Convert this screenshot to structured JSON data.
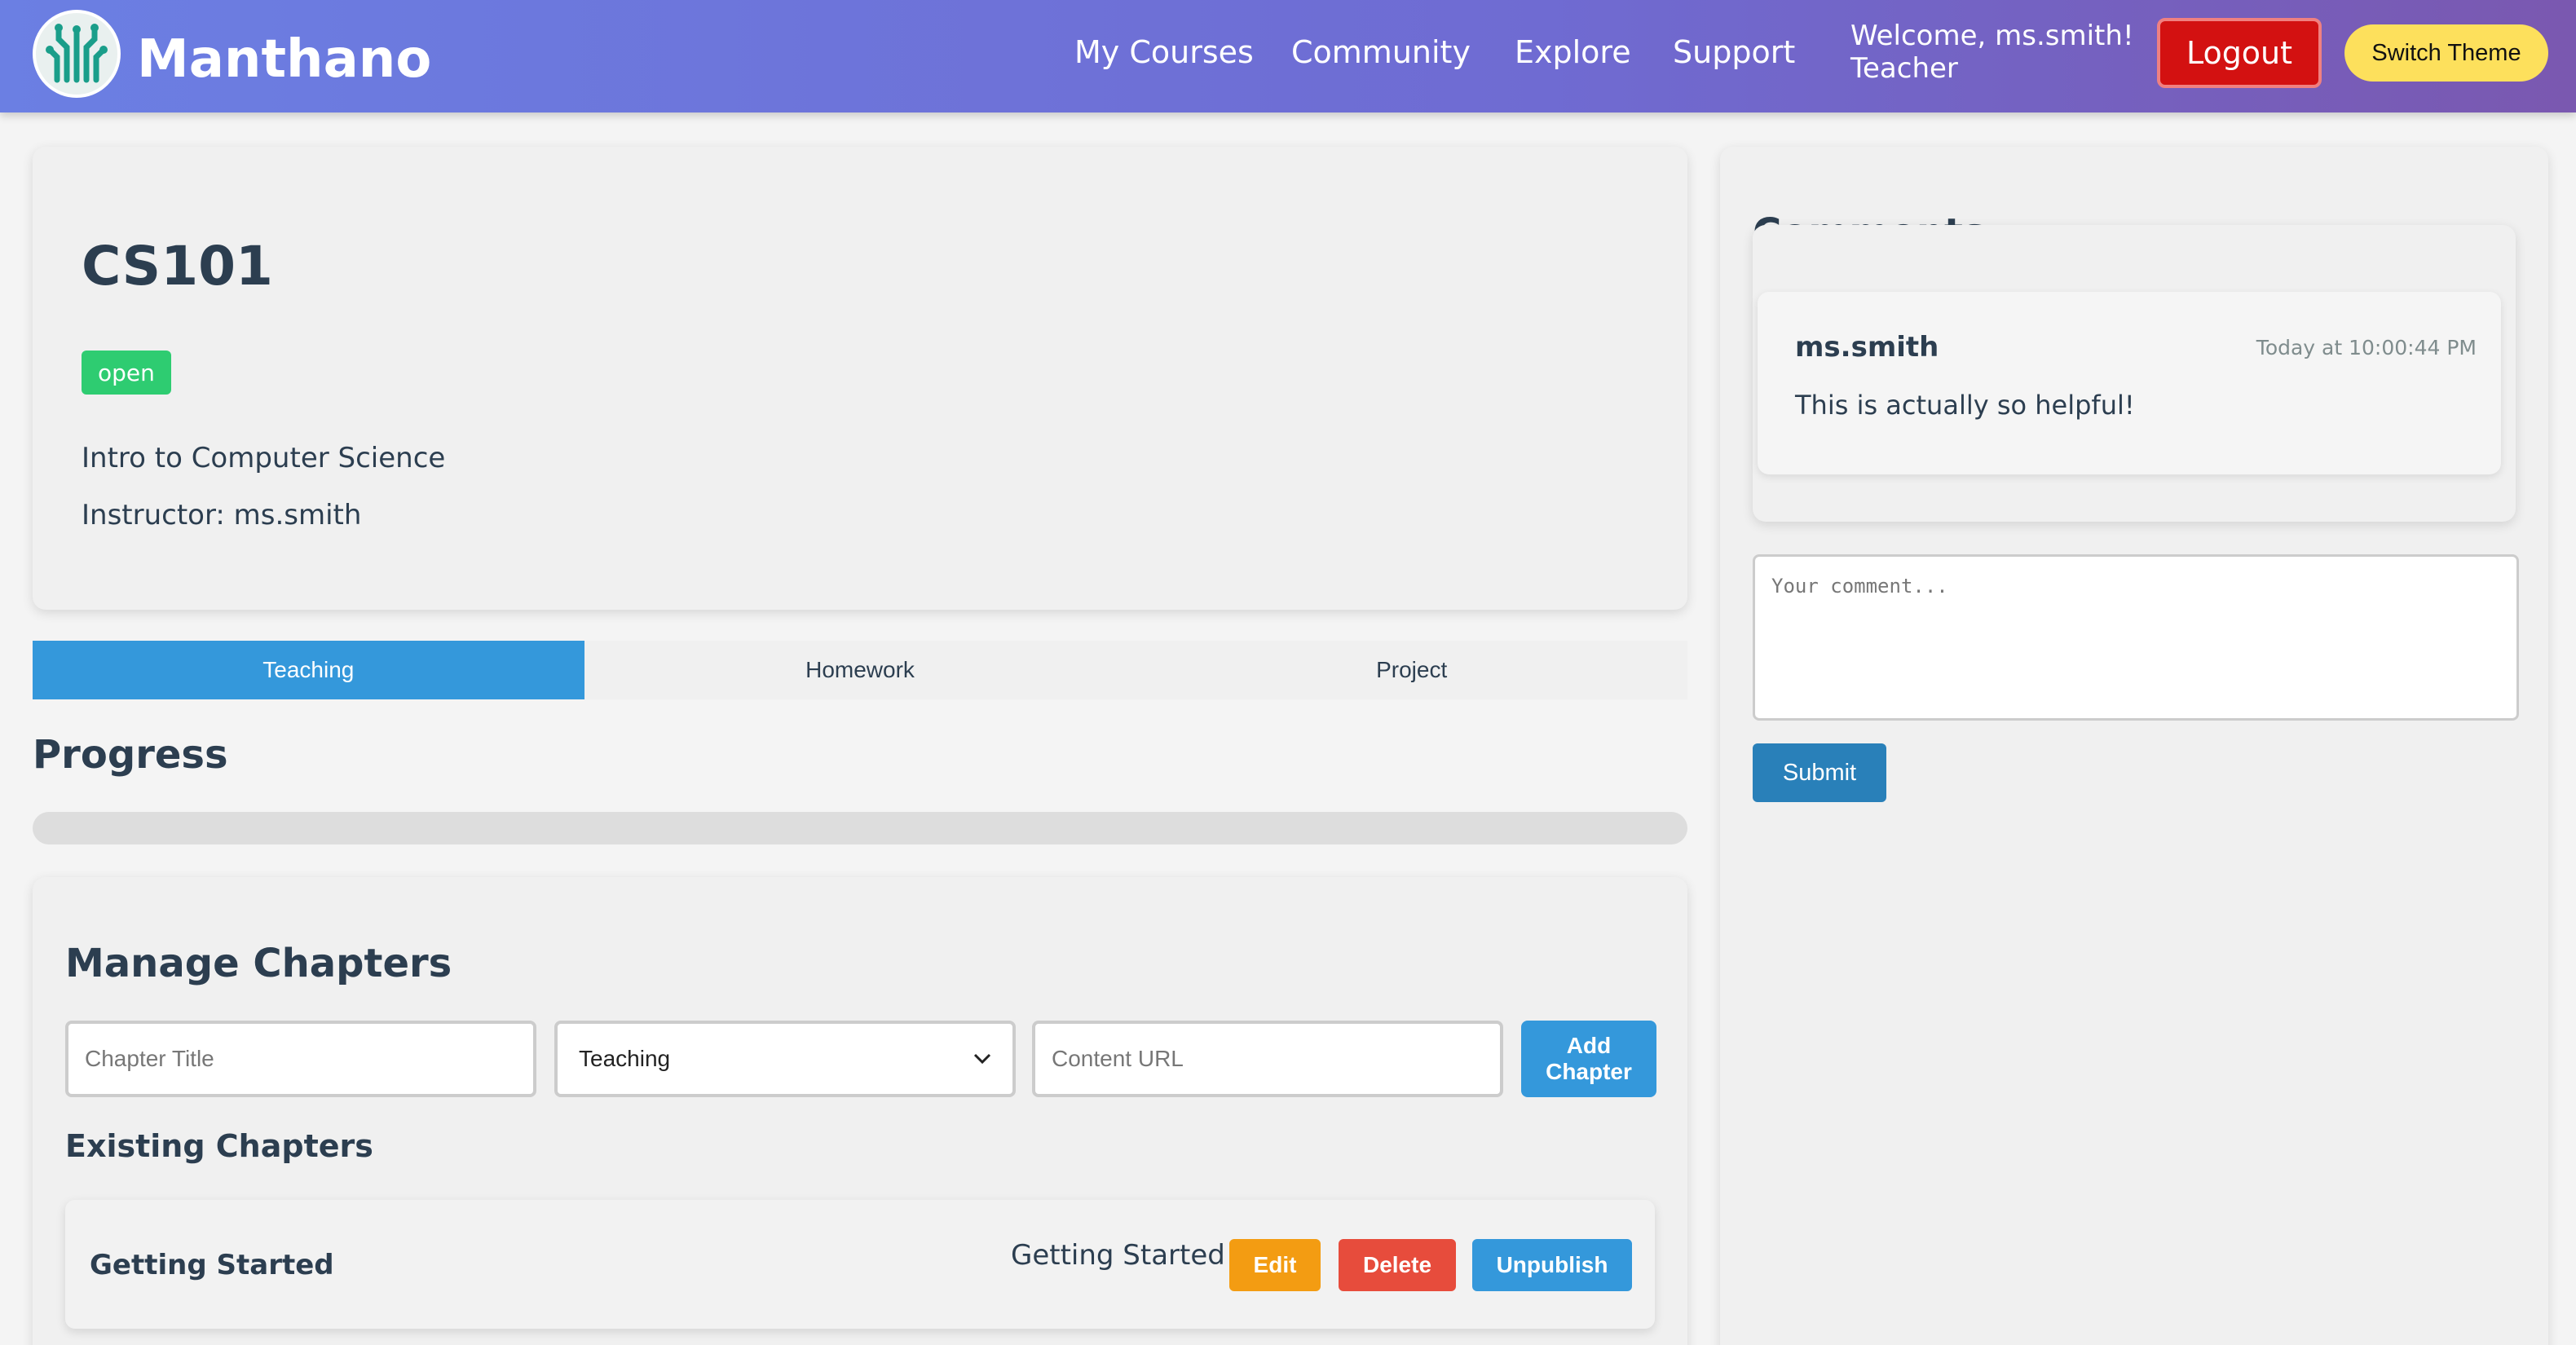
{
  "header": {
    "brand": "Manthano",
    "nav": [
      "My Courses",
      "Community",
      "Explore",
      "Support"
    ],
    "welcome": "Welcome, ms.smith!",
    "role": "Teacher",
    "logout_label": "Logout",
    "theme_label": "Switch Theme",
    "logo_icon": "circuit-tree-logo"
  },
  "course": {
    "code": "CS101",
    "status": "open",
    "description": "Intro to Computer Science",
    "instructor": "Instructor: ms.smith"
  },
  "tabs": [
    {
      "label": "Teaching",
      "active": true
    },
    {
      "label": "Homework",
      "active": false
    },
    {
      "label": "Project",
      "active": false
    }
  ],
  "progress": {
    "heading": "Progress",
    "value": 0
  },
  "manage": {
    "heading": "Manage Chapters",
    "title_placeholder": "Chapter Title",
    "type_selected": "Teaching",
    "url_placeholder": "Content URL",
    "add_label": "Add Chapter",
    "existing_heading": "Existing Chapters"
  },
  "chapters": [
    {
      "title": "Getting Started",
      "type": "Getting Started",
      "edit_label": "Edit",
      "delete_label": "Delete",
      "unpublish_label": "Unpublish"
    }
  ],
  "comments": {
    "heading": "Comments",
    "items": [
      {
        "author": "ms.smith",
        "time": "Today at 10:00:44 PM",
        "text": "This is actually so helpful!"
      }
    ],
    "input_placeholder": "Your comment...",
    "submit_label": "Submit"
  },
  "colors": {
    "accent": "#3498db",
    "header_gradient_start": "#6b7fe3",
    "header_gradient_end": "#7a58b0",
    "logout": "#d31111",
    "theme_button": "#fde05c",
    "status_open": "#2ecc71",
    "edit": "#f39c12",
    "delete": "#e74c3c"
  }
}
